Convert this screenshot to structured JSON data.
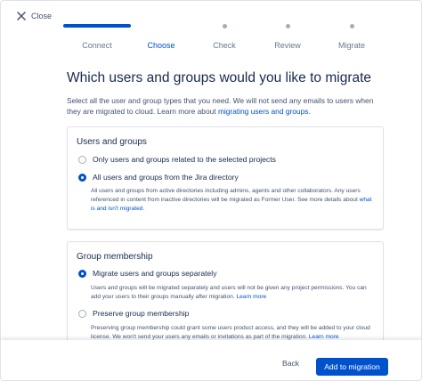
{
  "header": {
    "close_label": "Close"
  },
  "stepper": {
    "steps": [
      {
        "label": "Connect"
      },
      {
        "label": "Choose"
      },
      {
        "label": "Check"
      },
      {
        "label": "Review"
      },
      {
        "label": "Migrate"
      }
    ],
    "active_index": 1
  },
  "main": {
    "title": "Which users and groups would you like to migrate",
    "intro_text": "Select all the user and group types that you need. We will not send any emails to users when they are migrated to cloud. Learn more about ",
    "intro_link": "migrating users and groups",
    "intro_end": "."
  },
  "users_groups": {
    "title": "Users and groups",
    "option_related": "Only users and groups related to the selected projects",
    "option_all": "All users and groups from the Jira directory",
    "option_all_desc": "All users and groups from active directories including admins, agents and other collaborators. Any users referenced in content from inactive directories will be migrated as Former User. See more details about ",
    "option_all_link": "what is and isn't migrated",
    "option_all_end": "."
  },
  "group_membership": {
    "title": "Group membership",
    "option_separate": "Migrate users and groups separately",
    "option_separate_desc": "Users and groups will be migrated separately and users will not be given any project permissions. You can add your users to their groups manually after migration. ",
    "option_separate_link": "Learn more",
    "option_preserve": "Preserve group membership",
    "option_preserve_desc": "Preserving group membership could grant some users product access, and they will be added to your cloud license. We won't send your users any emails or invitations as part of the migration. ",
    "option_preserve_link": "Learn more"
  },
  "footer": {
    "back_label": "Back",
    "primary_label": "Add to migration"
  },
  "colors": {
    "accent": "#0052cc",
    "text": "#172b4d",
    "muted": "#6b778c"
  },
  "icons": {
    "close": "close-icon"
  }
}
